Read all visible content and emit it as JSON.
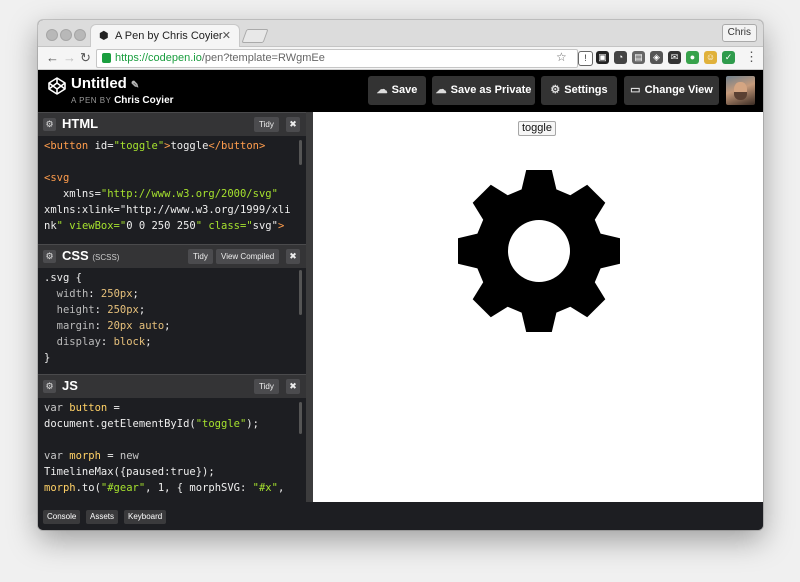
{
  "browser": {
    "tab_title": "A Pen by Chris Coyier",
    "profile_name": "Chris",
    "url_host": "https://codepen.io",
    "url_path": "/pen?template=RWgmEe"
  },
  "header": {
    "pen_title": "Untitled",
    "by_prefix": "A PEN BY",
    "author": "Chris Coyier",
    "buttons": {
      "save": "Save",
      "save_private": "Save as Private",
      "settings": "Settings",
      "change_view": "Change View"
    }
  },
  "editors": {
    "html": {
      "title": "HTML",
      "tidy": "Tidy",
      "lines": [
        "<button id=\"toggle\">toggle</button>",
        "",
        "<svg",
        "   xmlns=\"http://www.w3.org/2000/svg\"",
        "xmlns:xlink=\"http://www.w3.org/1999/xli",
        "nk\" viewBox=\"0 0 250 250\" class=\"svg\">"
      ]
    },
    "css": {
      "title": "CSS",
      "subtitle": "(SCSS)",
      "tidy": "Tidy",
      "view_compiled": "View Compiled",
      "lines": [
        ".svg {",
        "  width: 250px;",
        "  height: 250px;",
        "  margin: 20px auto;",
        "  display: block;",
        "}"
      ]
    },
    "js": {
      "title": "JS",
      "tidy": "Tidy",
      "lines": [
        "var button =",
        "document.getElementById(\"toggle\");",
        "",
        "var morph = new",
        "TimelineMax({paused:true});",
        "morph.to(\"#gear\", 1, { morphSVG: \"#x\","
      ]
    }
  },
  "preview": {
    "toggle_label": "toggle"
  },
  "footer": {
    "console": "Console",
    "assets": "Assets",
    "keyboard": "Keyboard"
  },
  "colors": {
    "chrome_bg": "#000000",
    "editor_bg": "#1d1e22",
    "url_green": "#1a9e3f"
  }
}
